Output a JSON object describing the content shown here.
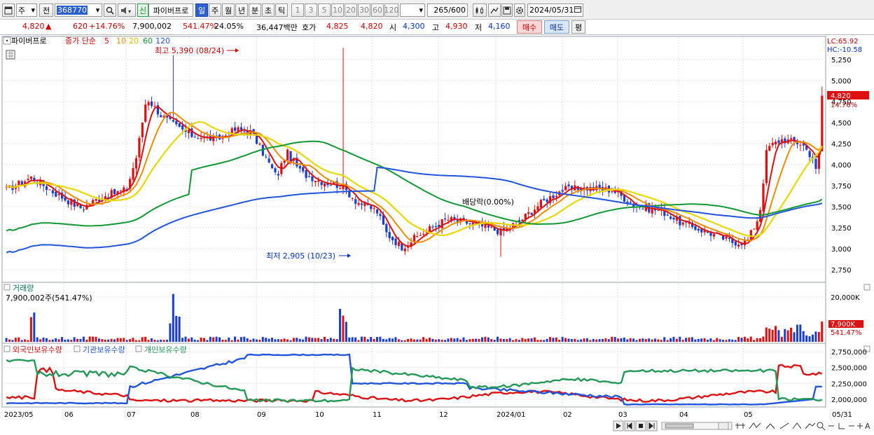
{
  "toolbar": {
    "market": "주",
    "prev_label": "전",
    "stock_code": "368770",
    "stock_name": "파이버프로",
    "credit_badge": "신",
    "periods": [
      "일",
      "주",
      "월",
      "년",
      "분",
      "초",
      "틱"
    ],
    "active_period": "일",
    "intervals": [
      "1",
      "3",
      "5",
      "10",
      "20",
      "30",
      "60",
      "120"
    ],
    "count": "265",
    "count_max": "/600",
    "date": "2024/05/31"
  },
  "quote": {
    "price": "4,820",
    "change_arrow": "▲",
    "change": "620",
    "change_pct": "+14.76%",
    "volume": "7,900,002",
    "volume_ratio": "541.47%",
    "turnover": "24.05%",
    "amount": "36,447백만",
    "ask_label": "호가",
    "ask": "4,825",
    "bid": "4,820",
    "open_label": "시",
    "open": "4,300",
    "high_label": "고",
    "high": "4,930",
    "low_label": "저",
    "low": "4,160",
    "buy_button": "매수",
    "sell_button": "매도",
    "eval_button": "평"
  },
  "price_panel": {
    "stock_tag": "파이버프로",
    "ma_title": "종가 단순",
    "ma_periods": [
      "5",
      "10",
      "20",
      "60",
      "120"
    ],
    "ma_colors": [
      "#e01010",
      "#f08c00",
      "#e8d800",
      "#119933",
      "#2255dd"
    ],
    "lc": "LC:65.92",
    "hc": "HC:-10.58",
    "high_annotation": "최고 5,390 (08/24)",
    "low_annotation": "최저 2,905 (10/23)",
    "dividend_annotation": "배당락(0.00%)",
    "current_price": "4,820",
    "current_pct": "14.76%",
    "y_ticks": [
      "5,250",
      "5,000",
      "4,750",
      "4,500",
      "4,250",
      "4,000",
      "3,750",
      "3,500",
      "3,250",
      "3,000",
      "2,750"
    ]
  },
  "volume_panel": {
    "title": "거래량",
    "value": "7,900,002주(541.47%)",
    "y_tick": "20,000K",
    "current": "7,900K",
    "current_pct": "541.47%"
  },
  "holding_panel": {
    "series": [
      "외국인보유수량",
      "기관보유수량",
      "개인보유수량"
    ],
    "colors": [
      "#dd1111",
      "#2255dd",
      "#229955"
    ],
    "y_ticks": [
      "2,750,000",
      "2,500,000",
      "2,250,000",
      "2,000,000"
    ]
  },
  "x_axis": {
    "labels": [
      "2023/05",
      "06",
      "07",
      "08",
      "09",
      "10",
      "11",
      "12",
      "2024/01",
      "02",
      "03",
      "04",
      "05",
      "05/31"
    ]
  }
}
